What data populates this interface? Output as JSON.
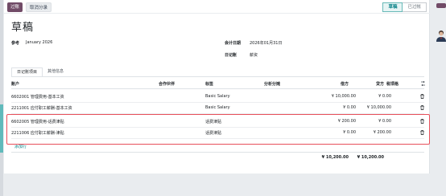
{
  "toolbar": {
    "post_label": "过账",
    "cancel_label": "取消分录"
  },
  "status": {
    "current": "草稿",
    "next": "已过帐"
  },
  "record": {
    "title": "草稿",
    "ref_label": "参考",
    "ref_value": "January 2026",
    "date_label": "会计日期",
    "date_value": "2026年01月31日",
    "journal_label": "日记账",
    "journal_value": "薪资"
  },
  "tabs": [
    {
      "label": "日记账项目",
      "active": true
    },
    {
      "label": "其他信息",
      "active": false
    }
  ],
  "table": {
    "headers": {
      "account": "账户",
      "partner": "合作伙伴",
      "label": "标签",
      "analytic": "分析分摊",
      "debit": "借方",
      "credit": "贷方",
      "tax": "税项格"
    },
    "rows": [
      {
        "account": "6602001 管理费用-基本工资",
        "label": "Basic Salary",
        "debit": "¥ 10,000.00",
        "credit": "¥ 0.00"
      },
      {
        "account": "2211001 应付职工薪酬-基本工资",
        "label": "Basic Salary",
        "debit": "¥ 0.00",
        "credit": "¥ 10,000.00"
      },
      {
        "account": "6602005 管理费用-话费津贴",
        "label": "话费津贴",
        "debit": "¥ 200.00",
        "credit": "¥ 0.00"
      },
      {
        "account": "2211006 应付职工薪酬-津贴",
        "label": "话费津贴",
        "debit": "¥ 0.00",
        "credit": "¥ 200.00"
      }
    ],
    "add_line": "添加行",
    "total_debit": "¥ 10,200.00",
    "total_credit": "¥ 10,200.00"
  },
  "icons": {
    "trash": "trash-icon",
    "settings": "column-settings-icon",
    "user": "user-avatar-icon"
  },
  "colors": {
    "brand": "#714b67",
    "accent": "#017e84",
    "highlight": "#e8505b"
  }
}
